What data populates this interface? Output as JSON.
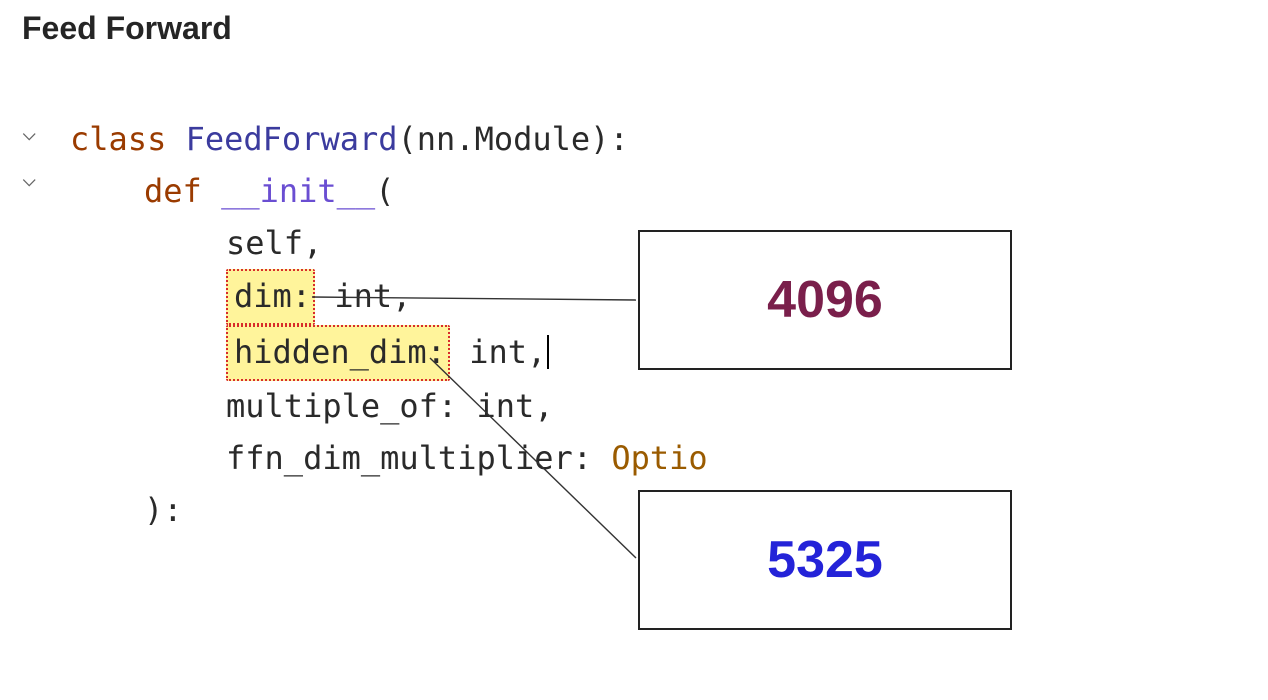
{
  "title": "Feed Forward",
  "code": {
    "class_keyword": "class",
    "class_name": "FeedForward",
    "class_base": "nn.Module",
    "def_keyword": "def",
    "init_name": "__init__",
    "params": {
      "self": "self",
      "dim_name": "dim",
      "dim_type": "int",
      "hidden_dim_name": "hidden_dim",
      "hidden_dim_type": "int",
      "multiple_of_name": "multiple_of",
      "multiple_of_type": "int",
      "ffn_mult_name": "ffn_dim_multiplier",
      "ffn_mult_type_partial": "Optio"
    }
  },
  "annotations": {
    "dim_value": "4096",
    "hidden_dim_value": "5325"
  },
  "icons": {
    "chevron_open": "⌵"
  }
}
